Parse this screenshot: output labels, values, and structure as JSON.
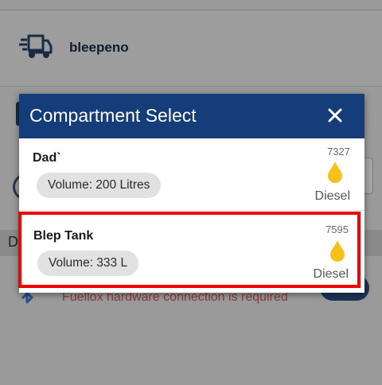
{
  "background": {
    "vehicle_name": "bleepeno",
    "band_letter": "D",
    "hardware_notice": "Fuellox hardware connection is required"
  },
  "dialog": {
    "title": "Compartment Select",
    "compartments": [
      {
        "name": "Dad`",
        "volume": "Volume: 200 Litres",
        "id": "7327",
        "fuel_type": "Diesel",
        "fuel_icon": "fuel-drop-icon"
      },
      {
        "name": "Blep Tank",
        "volume": "Volume: 333 L",
        "id": "7595",
        "fuel_type": "Diesel",
        "fuel_icon": "fuel-drop-icon",
        "highlighted": true
      }
    ]
  },
  "colors": {
    "header_blue": "#143d79",
    "drop_yellow": "#f6c21a",
    "highlight_red": "#ef0000",
    "chip_grey": "#e1e1e1",
    "overlay_grey": "#9a9a9a"
  }
}
